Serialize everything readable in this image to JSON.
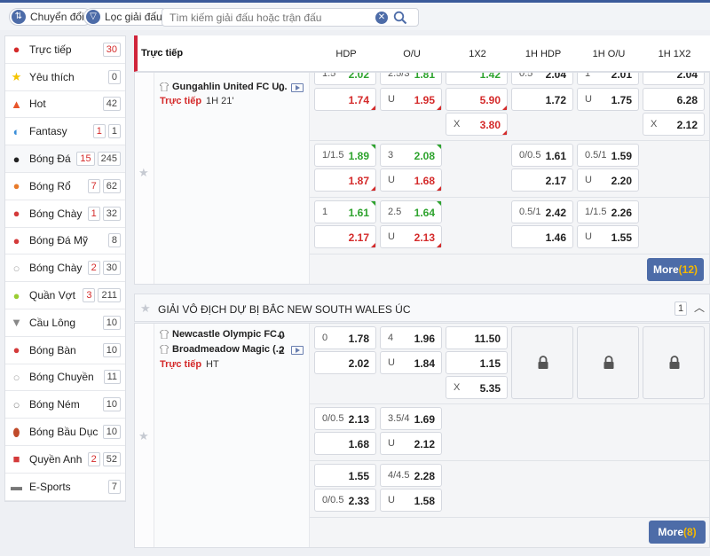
{
  "toolbar": {
    "switch_label": "Chuyển đổi",
    "filter_label": "Lọc giải đấu",
    "search_placeholder": "Tìm kiếm giải đấu hoặc trận đấu"
  },
  "sidebar": {
    "items": [
      {
        "label": "Trực tiếp",
        "counts": [
          "30"
        ],
        "live": [
          true
        ],
        "icon": "live-icon",
        "color": "#d42a2a"
      },
      {
        "label": "Yêu thích",
        "counts": [
          "0"
        ],
        "live": [
          false
        ],
        "icon": "star-icon",
        "color": "#f5c400"
      },
      {
        "label": "Hot",
        "counts": [
          "42"
        ],
        "live": [
          false
        ],
        "icon": "fire-icon",
        "color": "#e8552a"
      },
      {
        "label": "Fantasy",
        "counts": [
          "1",
          "1"
        ],
        "live": [
          true,
          false
        ],
        "icon": "fantasy-icon",
        "color": "#3a8ed8"
      },
      {
        "label": "Bóng Đá",
        "counts": [
          "15",
          "245"
        ],
        "live": [
          true,
          false
        ],
        "icon": "soccer-ball-icon",
        "color": "#222222"
      },
      {
        "label": "Bóng Rổ",
        "counts": [
          "7",
          "62"
        ],
        "live": [
          true,
          false
        ],
        "icon": "basketball-icon",
        "color": "#e87a2a"
      },
      {
        "label": "Bóng Chày",
        "counts": [
          "1",
          "32"
        ],
        "live": [
          true,
          false
        ],
        "icon": "baseball-icon",
        "color": "#d43a3a"
      },
      {
        "label": "Bóng Đá Mỹ",
        "counts": [
          "8"
        ],
        "live": [
          false
        ],
        "icon": "football-helmet-icon",
        "color": "#d43a3a"
      },
      {
        "label": "Bóng Chày",
        "counts": [
          "2",
          "30"
        ],
        "live": [
          true,
          false
        ],
        "icon": "softball-icon",
        "color": "#aaaaaa"
      },
      {
        "label": "Quần Vợt",
        "counts": [
          "3",
          "211"
        ],
        "live": [
          true,
          false
        ],
        "icon": "tennis-ball-icon",
        "color": "#9acd32"
      },
      {
        "label": "Cầu Lông",
        "counts": [
          "10"
        ],
        "live": [
          false
        ],
        "icon": "shuttlecock-icon",
        "color": "#888888"
      },
      {
        "label": "Bóng Bàn",
        "counts": [
          "10"
        ],
        "live": [
          false
        ],
        "icon": "ping-pong-icon",
        "color": "#d43a3a"
      },
      {
        "label": "Bóng Chuyền",
        "counts": [
          "11"
        ],
        "live": [
          false
        ],
        "icon": "volleyball-icon",
        "color": "#aaaaaa"
      },
      {
        "label": "Bóng Ném",
        "counts": [
          "10"
        ],
        "live": [
          false
        ],
        "icon": "handball-icon",
        "color": "#888888"
      },
      {
        "label": "Bóng Bầu Dục",
        "counts": [
          "10"
        ],
        "live": [
          false
        ],
        "icon": "rugby-ball-icon",
        "color": "#c04a2a"
      },
      {
        "label": "Quyền Anh",
        "counts": [
          "2",
          "52"
        ],
        "live": [
          true,
          false
        ],
        "icon": "boxing-glove-icon",
        "color": "#d43a3a"
      },
      {
        "label": "E-Sports",
        "counts": [
          "7"
        ],
        "live": [
          false
        ],
        "icon": "gamepad-icon",
        "color": "#777777"
      }
    ]
  },
  "header": {
    "title": "Trực tiếp",
    "columns": [
      "HDP",
      "O/U",
      "1X2",
      "1H HDP",
      "1H O/U",
      "1H 1X2"
    ]
  },
  "match1": {
    "team_home": "Gungahlin United FC U...",
    "score_home": "0",
    "live_label": "Trực tiếp",
    "live_time": "1H 21'",
    "top_partial": {
      "hdp_h": "1.5",
      "hdp_o": "2.02",
      "ou_h": "2.5/3",
      "ou_o": "1.81",
      "x12": "1.42",
      "h1hdp_h": "0.5",
      "h1hdp_o": "2.04",
      "h1ou_h": "1",
      "h1ou_o": "2.01",
      "h1x12": "2.04"
    },
    "row1": {
      "hdp": "1.74",
      "ou_h": "U",
      "ou": "1.95",
      "x12": "5.90",
      "h1hdp": "1.72",
      "h1ou_h": "U",
      "h1ou": "1.75",
      "h1x12": "6.28"
    },
    "row1x": {
      "x12_h": "X",
      "x12": "3.80",
      "h1x12_h": "X",
      "h1x12": "2.12"
    },
    "line2": {
      "hdp_h": "1/1.5",
      "hdp_o": "1.89",
      "hdp_o2": "1.87",
      "ou_h": "3",
      "ou_o": "2.08",
      "ou_h2": "U",
      "ou_o2": "1.68",
      "h1hdp_h": "0/0.5",
      "h1hdp_o": "1.61",
      "h1hdp_o2": "2.17",
      "h1ou_h": "0.5/1",
      "h1ou_o": "1.59",
      "h1ou_h2": "U",
      "h1ou_o2": "2.20"
    },
    "line3": {
      "hdp_h": "1",
      "hdp_o": "1.61",
      "hdp_o2": "2.17",
      "ou_h": "2.5",
      "ou_o": "1.64",
      "ou_h2": "U",
      "ou_o2": "2.13",
      "h1hdp_h": "0.5/1",
      "h1hdp_o": "2.42",
      "h1hdp_o2": "1.46",
      "h1ou_h": "1/1.5",
      "h1ou_o": "2.26",
      "h1ou_h2": "U",
      "h1ou_o2": "1.55"
    },
    "more_label": "More",
    "more_count": "(12)"
  },
  "league2": {
    "name": "GIẢI VÔ ĐỊCH DỰ BỊ BẮC NEW SOUTH WALES ÚC",
    "count": "1"
  },
  "match2": {
    "team_home": "Newcastle Olympic FC...",
    "team_away": "Broadmeadow Magic (...",
    "score_home": "0",
    "score_away": "2",
    "live_label": "Trực tiếp",
    "live_time": "HT",
    "line1": {
      "hdp_h": "0",
      "hdp_o": "1.78",
      "hdp_o2": "2.02",
      "ou_h": "4",
      "ou_o": "1.96",
      "ou_h2": "U",
      "ou_o2": "1.84",
      "x12_1": "11.50",
      "x12_2": "1.15",
      "x12_h3": "X",
      "x12_3": "5.35"
    },
    "line2": {
      "hdp_h": "0/0.5",
      "hdp_o": "2.13",
      "hdp_o2": "1.68",
      "ou_h": "3.5/4",
      "ou_o": "1.69",
      "ou_h2": "U",
      "ou_o2": "2.12"
    },
    "line3": {
      "hdp_o": "1.55",
      "hdp_h2": "0/0.5",
      "hdp_o2": "2.33",
      "ou_h": "4/4.5",
      "ou_o": "2.28",
      "ou_h2": "U",
      "ou_o2": "1.58"
    },
    "more_label": "More",
    "more_count": "(8)"
  }
}
